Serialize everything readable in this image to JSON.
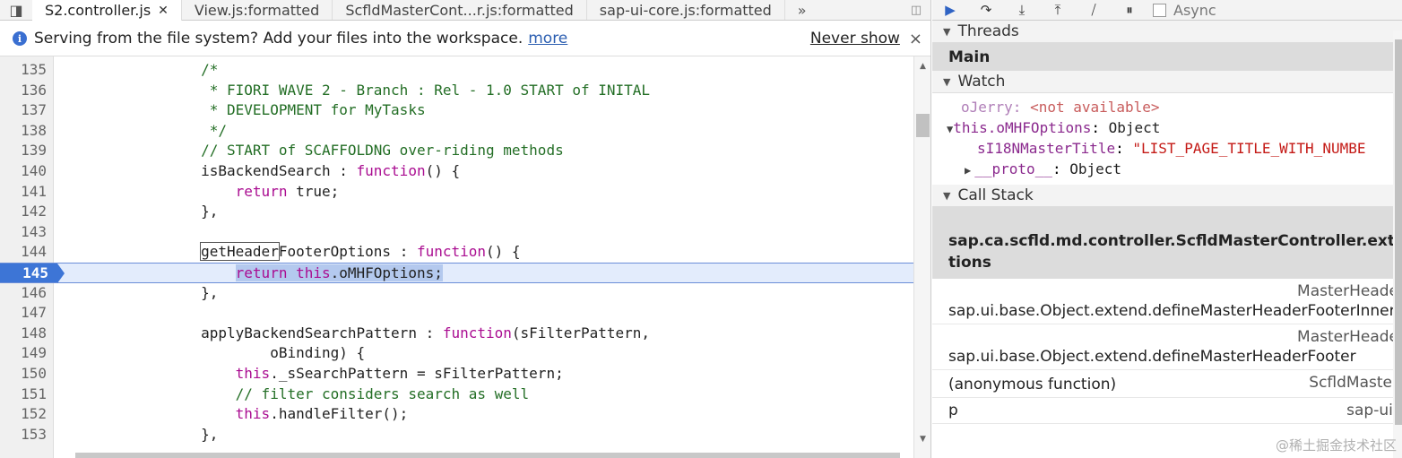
{
  "tabs": [
    {
      "label": "S2.controller.js",
      "active": true,
      "closable": true
    },
    {
      "label": "View.js:formatted"
    },
    {
      "label": "ScfldMasterCont...r.js:formatted"
    },
    {
      "label": "sap-ui-core.js:formatted"
    }
  ],
  "tab_overflow": "»",
  "infobar": {
    "message": "Serving from the file system? Add your files into the workspace.",
    "more_link": "more",
    "never_show": "Never show",
    "close": "×"
  },
  "editor": {
    "lines": [
      {
        "n": "135",
        "html": "                /*"
      },
      {
        "n": "136",
        "html": "                 * FIORI WAVE 2 - Branch : Rel - 1.0 START of INITAL"
      },
      {
        "n": "137",
        "html": "                 * DEVELOPMENT for MyTasks"
      },
      {
        "n": "138",
        "html": "                 */"
      },
      {
        "n": "139",
        "html": "                // START of SCAFFOLDNG over-riding methods"
      },
      {
        "n": "140",
        "html": "                isBackendSearch : function() {"
      },
      {
        "n": "141",
        "html": "                    return true;"
      },
      {
        "n": "142",
        "html": "                },"
      },
      {
        "n": "143",
        "html": ""
      },
      {
        "n": "144",
        "html": "                getHeaderFooterOptions : function() {"
      },
      {
        "n": "145",
        "html": "                    return this.oMHFOptions;",
        "exec": true
      },
      {
        "n": "146",
        "html": "                },"
      },
      {
        "n": "147",
        "html": ""
      },
      {
        "n": "148",
        "html": "                applyBackendSearchPattern : function(sFilterPattern,"
      },
      {
        "n": "149",
        "html": "                        oBinding) {"
      },
      {
        "n": "150",
        "html": "                    this._sSearchPattern = sFilterPattern;"
      },
      {
        "n": "151",
        "html": "                    // filter considers search as well"
      },
      {
        "n": "152",
        "html": "                    this.handleFilter();"
      },
      {
        "n": "153",
        "html": "                },"
      }
    ]
  },
  "debugger": {
    "async_label": "Async",
    "threads_header": "Threads",
    "main_thread": "Main",
    "watch_header": "Watch",
    "watch": {
      "item1_name": "oJerry",
      "item1_value": "<not available>",
      "item2_name": "this.oMHFOptions",
      "item2_value": "Object",
      "item2_child_name": "sI18NMasterTitle",
      "item2_child_value": "\"LIST_PAGE_TITLE_WITH_NUMBE",
      "item2_proto_name": "__proto__",
      "item2_proto_value": "Object"
    },
    "callstack_header": "Call Stack",
    "callstack": {
      "selected_line1": "sap.ca.scfld.md.controller.ScfldMasterController.extend.",
      "selected_line2": "tions",
      "item1_loc": "MasterHeade",
      "item1_fn": "sap.ui.base.Object.extend.defineMasterHeaderFooterInner",
      "item2_loc": "MasterHeade",
      "item2_fn": "sap.ui.base.Object.extend.defineMasterHeaderFooter",
      "item3_fn": "(anonymous function)",
      "item3_loc": "ScfldMaster",
      "item4_fn": "p",
      "item4_loc": "sap-ui-"
    }
  },
  "watermark": "@稀土掘金技术社区"
}
